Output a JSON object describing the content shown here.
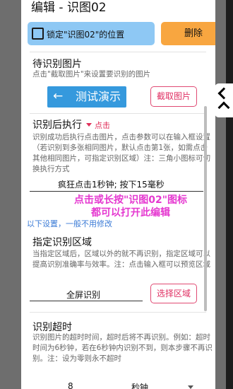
{
  "dialog": {
    "title": "编辑 - 识图02",
    "lock_label": "锁定\"识图02\"的位置",
    "delete_label": "删除"
  },
  "pending": {
    "title": "待识别图片",
    "desc": "点击\"截取图片\"来设置要识别的图片",
    "demo_label": "测试演示",
    "capture_label": "截取图片"
  },
  "after_action": {
    "title": "识别后执行",
    "selected": "点击",
    "desc": "识别成功后执行点击图片，点击参数可以在输入框设置（若识别到多张相同图片，默认点击第1张，如需点击其他相同图片，可指定识别区域）注：三角小图标可切换执行方式",
    "input_value": "疯狂点击1秒钟; 按下15毫秒"
  },
  "tip": {
    "line1": "点击或长按\"识图02\"图标",
    "line2": "都可以打开此编辑",
    "below": "以下设置，一般不用修改"
  },
  "region": {
    "title": "指定识别区域",
    "desc": "当指定区域后，区域以外的就不再识别，指定区域可以提高识别准确率与效率。注：点击输入框可以预览区域",
    "value": "全屏识别",
    "button": "选择区域"
  },
  "timeout": {
    "title": "识别超时",
    "desc": "识别图片的超时时间，超时后将不再识别。例如：超时时间为6秒钟，若在6秒钟内识别不到，则本步骤不再识别。注：设为零则永不超时",
    "value": "8",
    "unit": "秒钟"
  },
  "icons": {
    "back": "←",
    "checkbox": "checkbox-icon",
    "dropdown": "triangle-down-icon"
  }
}
